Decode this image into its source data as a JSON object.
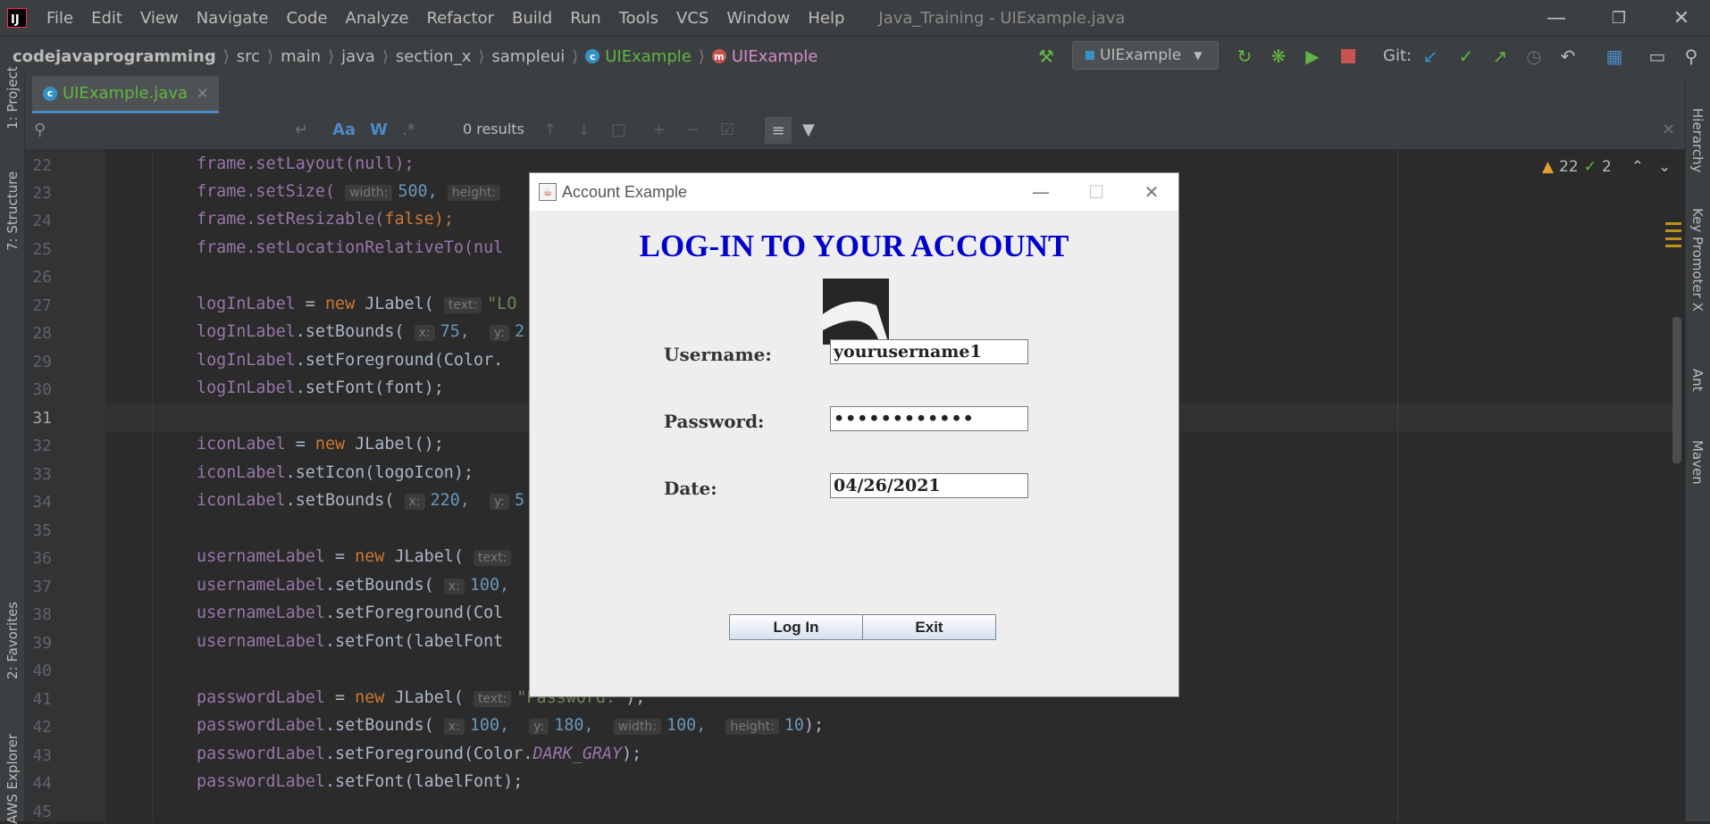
{
  "menubar": {
    "items": [
      "File",
      "Edit",
      "View",
      "Navigate",
      "Code",
      "Analyze",
      "Refactor",
      "Build",
      "Run",
      "Tools",
      "VCS",
      "Window",
      "Help"
    ],
    "window_title": "Java_Training - UIExample.java",
    "logo_text": "IJ"
  },
  "navbar": {
    "breadcrumbs": [
      "codejavaprogramming",
      "src",
      "main",
      "java",
      "section_x",
      "sampleui",
      "UIExample",
      "UIExample"
    ],
    "run_config": "UIExample",
    "git_label": "Git:"
  },
  "left_panels": [
    "1: Project",
    "7: Structure",
    "2: Favorites",
    "AWS Explorer"
  ],
  "right_panels": [
    "Hierarchy",
    "Key Promoter X",
    "Ant",
    "Maven"
  ],
  "editor": {
    "tab_label": "UIExample.java",
    "find_results": "0 results",
    "find_options": [
      "Aa",
      "W",
      ".*"
    ],
    "warnings_count": "22",
    "checks_count": "2",
    "current_line": 31
  },
  "code_lines": [
    {
      "n": "22"
    },
    {
      "n": "23"
    },
    {
      "n": "24"
    },
    {
      "n": "25"
    },
    {
      "n": "26"
    },
    {
      "n": "27"
    },
    {
      "n": "28"
    },
    {
      "n": "29"
    },
    {
      "n": "30"
    },
    {
      "n": "31"
    },
    {
      "n": "32"
    },
    {
      "n": "33"
    },
    {
      "n": "34"
    },
    {
      "n": "35"
    },
    {
      "n": "36"
    },
    {
      "n": "37"
    },
    {
      "n": "38"
    },
    {
      "n": "39"
    },
    {
      "n": "40"
    },
    {
      "n": "41"
    },
    {
      "n": "42"
    },
    {
      "n": "43"
    },
    {
      "n": "44"
    },
    {
      "n": "45"
    }
  ],
  "code": {
    "l22": "frame.setLayout(null);",
    "l23a": "frame.setSize(",
    "l23h1": "width:",
    "l23v1": "500,",
    "l23h2": "height:",
    "l24a": "frame.setResizable(",
    "l24b": "false",
    "l24c": ");",
    "l25": "frame.setLocationRelativeTo(nul",
    "l27a": "logInLabel",
    "l27b": " = ",
    "l27c": "new",
    "l27d": " JLabel(",
    "l27h": "text:",
    "l27s": "\"LO",
    "l28a": "logInLabel",
    "l28b": ".setBounds(",
    "l28h": "x:",
    "l28v": "75,",
    "l28h2": "y:",
    "l28v2": "2",
    "l29a": "logInLabel",
    "l29b": ".setForeground(Color.",
    "l30a": "logInLabel",
    "l30b": ".setFont(font);",
    "l32a": "iconLabel",
    "l32b": " = ",
    "l32c": "new",
    "l32d": " JLabel();",
    "l33a": "iconLabel",
    "l33b": ".setIcon(logoIcon);",
    "l34a": "iconLabel",
    "l34b": ".setBounds(",
    "l34h": "x:",
    "l34v": "220,",
    "l34h2": "y:",
    "l34v2": "5",
    "l36a": "usernameLabel",
    "l36b": " = ",
    "l36c": "new",
    "l36d": " JLabel(",
    "l36h": "text:",
    "l37a": "usernameLabel",
    "l37b": ".setBounds(",
    "l37h": "x:",
    "l37v": "100,",
    "l38a": "usernameLabel",
    "l38b": ".setForeground(Col",
    "l39a": "usernameLabel",
    "l39b": ".setFont(labelFont",
    "l41a": "passwordLabel",
    "l41b": " = ",
    "l41c": "new",
    "l41d": " JLabel(",
    "l41h": "text:",
    "l41s": "\"Password:\"",
    "l41e": ");",
    "l42a": "passwordLabel",
    "l42b": ".setBounds(",
    "l42h1": "x:",
    "l42v1": "100,",
    "l42h2": "y:",
    "l42v2": "180,",
    "l42h3": "width:",
    "l42v3": "100,",
    "l42h4": "height:",
    "l42v4": "10",
    "l42e": ");",
    "l43a": "passwordLabel",
    "l43b": ".setForeground(Color.",
    "l43c": "DARK_GRAY",
    "l43d": ");",
    "l44a": "passwordLabel",
    "l44b": ".setFont(labelFont);"
  },
  "dialog": {
    "title": "Account Example",
    "heading": "LOG-IN TO YOUR ACCOUNT",
    "username_label": "Username:",
    "username_value": "yourusername1",
    "password_label": "Password:",
    "password_value": "••••••••••••",
    "date_label": "Date:",
    "date_value": "04/26/2021",
    "login_button": "Log In",
    "exit_button": "Exit"
  },
  "colors": {
    "heading": "#0000cc",
    "accent_green": "#62b543",
    "accent_blue": "#4a88c7"
  }
}
